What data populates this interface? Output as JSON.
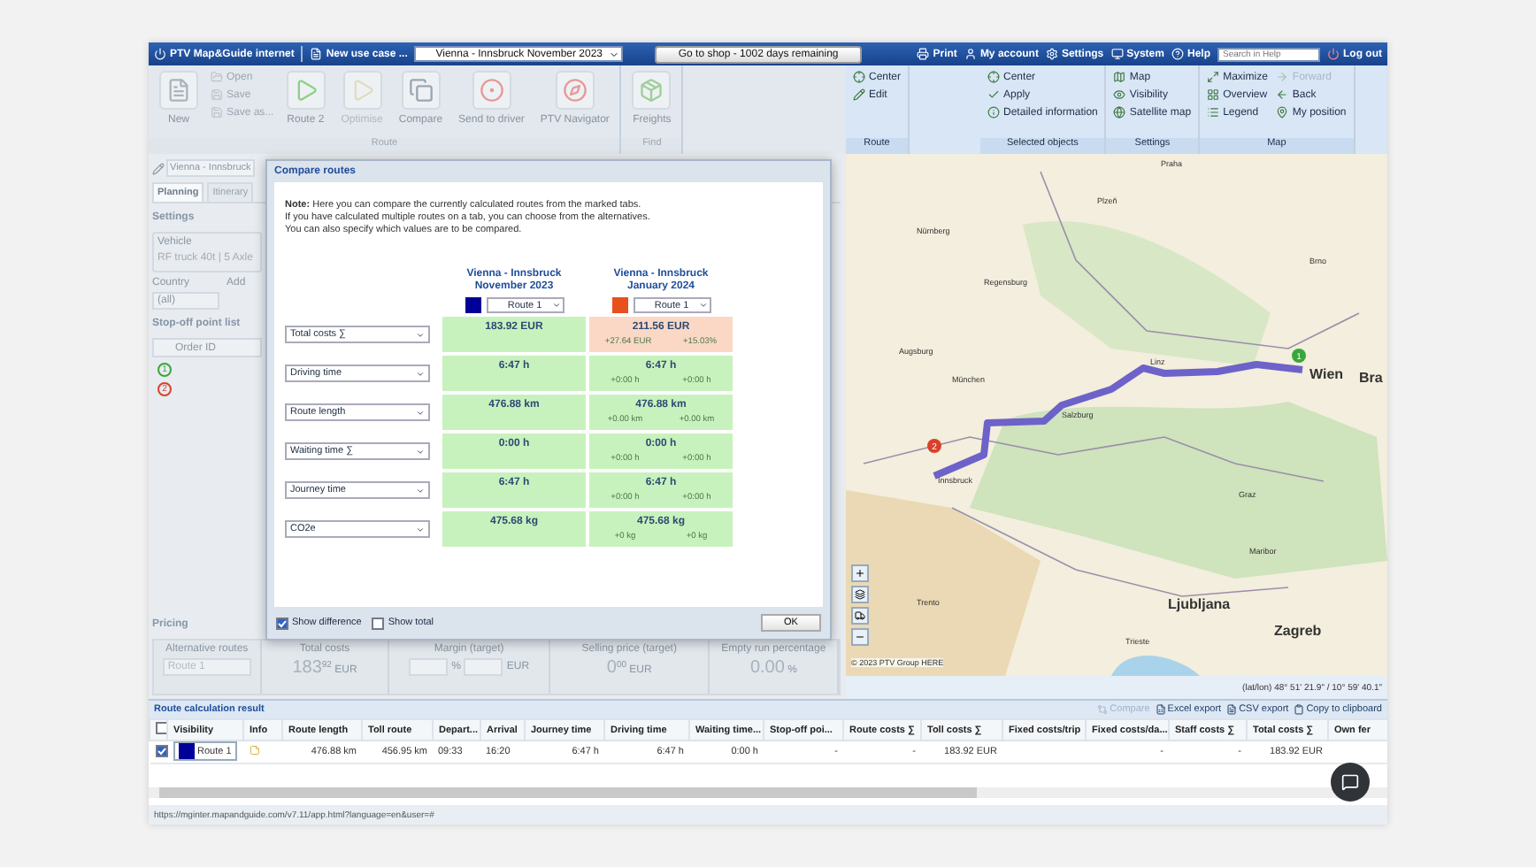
{
  "top_bar": {
    "app_title": "PTV Map&Guide internet",
    "new_use_case": "New use case ...",
    "tour_select": "Vienna - Innsbruck November 2023",
    "shop_button": "Go to shop - 1002 days remaining",
    "links": [
      "Print",
      "My account",
      "Settings",
      "System",
      "Help"
    ],
    "search": {
      "placeholder": "Search in Help"
    },
    "logout": "Log out"
  },
  "ribbon": {
    "left_groups": [
      {
        "label": "Route",
        "items": [
          {
            "kind": "big",
            "label": "New",
            "disabled": false
          },
          {
            "kind": "stack",
            "items": [
              {
                "label": "Open",
                "disabled": false
              },
              {
                "label": "Save",
                "disabled": false
              },
              {
                "label": "Save as...",
                "disabled": false
              }
            ]
          },
          {
            "kind": "big",
            "label": "Route 2",
            "disabled": false
          },
          {
            "kind": "big",
            "label": "Optimise",
            "disabled": true
          },
          {
            "kind": "big",
            "label": "Compare",
            "disabled": false
          },
          {
            "kind": "big",
            "label": "Send to driver",
            "disabled": false
          },
          {
            "kind": "big",
            "label": "PTV Navigator",
            "disabled": false
          }
        ]
      },
      {
        "label": "Find",
        "items": [
          {
            "kind": "big",
            "label": "Freights",
            "disabled": false
          }
        ]
      }
    ],
    "right_groups": [
      {
        "label": "Route",
        "columns": [
          [
            {
              "label": "Center",
              "disabled": false
            },
            {
              "label": "Edit",
              "disabled": false
            }
          ]
        ]
      },
      {
        "label": "Selected objects",
        "columns": [
          [
            {
              "label": "Center",
              "disabled": false
            },
            {
              "label": "Apply",
              "disabled": false
            },
            {
              "label": "Detailed information",
              "disabled": false
            }
          ]
        ]
      },
      {
        "label": "Settings",
        "columns": [
          [
            {
              "label": "Map",
              "disabled": false
            },
            {
              "label": "Visibility",
              "disabled": false
            },
            {
              "label": "Satellite map",
              "disabled": false
            }
          ]
        ]
      },
      {
        "label": "Map",
        "columns": [
          [
            {
              "label": "Maximize",
              "disabled": false
            },
            {
              "label": "Overview",
              "disabled": false
            },
            {
              "label": "Legend",
              "disabled": false
            }
          ],
          [
            {
              "label": "Forward",
              "disabled": true
            },
            {
              "label": "Back",
              "disabled": false
            },
            {
              "label": "My position",
              "disabled": false
            }
          ]
        ]
      }
    ]
  },
  "tour_tab": "Vienna - Innsbruck",
  "tabs": [
    {
      "label": "Planning",
      "selected": true
    },
    {
      "label": "Itinerary",
      "selected": false
    }
  ],
  "settings": {
    "title": "Settings",
    "vehicle_label": "Vehicle",
    "vehicle_value": "RF truck 40t | 5 Axle",
    "country_label": "Country",
    "country_value": "(all)",
    "address_label": "Add"
  },
  "stop_list": {
    "title": "Stop-off point list",
    "column": "Order ID",
    "stops": [
      {
        "number": "1",
        "color": "#3aa63a"
      },
      {
        "number": "2",
        "color": "#d9412b"
      }
    ]
  },
  "pricing": {
    "title": "Pricing",
    "alternative_routes": {
      "label": "Alternative routes",
      "value": "Route 1",
      "disabled": true
    },
    "total_costs": {
      "label": "Total costs",
      "integer": "183",
      "decimals": "92",
      "unit": "EUR"
    },
    "margin": {
      "label": "Margin (target)",
      "units": [
        "%",
        "EUR"
      ]
    },
    "selling_price": {
      "label": "Selling price (target)",
      "integer": "0",
      "decimals": "00",
      "unit": "EUR"
    },
    "empty_run": {
      "label": "Empty run percentage",
      "value": "0.00",
      "unit": "%"
    }
  },
  "dialog": {
    "title": "Compare routes",
    "note": [
      "**Note:** Here you can compare the currently calculated routes from the marked tabs.",
      "If you have calculated multiple routes on a tab, you can choose from the alternatives.",
      "You can also specify which values are to be compared."
    ],
    "routes": [
      {
        "name": "Vienna - Innsbruck November 2023",
        "color": "#000099",
        "alternative": "Route 1"
      },
      {
        "name": "Vienna - Innsbruck January 2024",
        "color": "#e8501e",
        "alternative": "Route 1"
      }
    ],
    "rows": [
      {
        "criterion": "Total costs ∑",
        "cells": [
          {
            "value": "183.92 EUR",
            "worse": false
          },
          {
            "value": "211.56 EUR",
            "worse": true,
            "diffs": [
              "+27.64 EUR",
              "+15.03%"
            ]
          }
        ]
      },
      {
        "criterion": "Driving time",
        "cells": [
          {
            "value": "6:47 h",
            "worse": false
          },
          {
            "value": "6:47 h",
            "worse": false,
            "diffs": [
              "+0:00 h",
              "+0:00 h"
            ]
          }
        ]
      },
      {
        "criterion": "Route length",
        "cells": [
          {
            "value": "476.88 km",
            "worse": false
          },
          {
            "value": "476.88 km",
            "worse": false,
            "diffs": [
              "+0.00 km",
              "+0.00 km"
            ]
          }
        ]
      },
      {
        "criterion": "Waiting time ∑",
        "cells": [
          {
            "value": "0:00 h",
            "worse": false
          },
          {
            "value": "0:00 h",
            "worse": false,
            "diffs": [
              "+0:00 h",
              "+0:00 h"
            ]
          }
        ]
      },
      {
        "criterion": "Journey time",
        "cells": [
          {
            "value": "6:47 h",
            "worse": false
          },
          {
            "value": "6:47 h",
            "worse": false,
            "diffs": [
              "+0:00 h",
              "+0:00 h"
            ]
          }
        ]
      },
      {
        "criterion": "CO2e",
        "cells": [
          {
            "value": "475.68 kg",
            "worse": false
          },
          {
            "value": "475.68 kg",
            "worse": false,
            "diffs": [
              "+0 kg",
              "+0 kg"
            ]
          }
        ]
      }
    ],
    "options": [
      {
        "label": "Show difference",
        "checked": true
      },
      {
        "label": "Show total",
        "checked": false
      }
    ],
    "ok": "OK"
  },
  "map": {
    "labels": [
      {
        "text": "Praha",
        "kind": "minor"
      },
      {
        "text": "Plzeň",
        "kind": "minor"
      },
      {
        "text": "Nürnberg",
        "kind": "minor"
      },
      {
        "text": "Brno",
        "kind": "minor"
      },
      {
        "text": "Regensburg",
        "kind": "minor"
      },
      {
        "text": "Augsburg",
        "kind": "minor"
      },
      {
        "text": "München",
        "kind": "minor"
      },
      {
        "text": "Linz",
        "kind": "minor"
      },
      {
        "text": "Wien",
        "kind": "major"
      },
      {
        "text": "Bra",
        "kind": "major"
      },
      {
        "text": "Salzburg",
        "kind": "minor"
      },
      {
        "text": "Innsbruck",
        "kind": "minor"
      },
      {
        "text": "Graz",
        "kind": "minor"
      },
      {
        "text": "Maribor",
        "kind": "minor"
      },
      {
        "text": "Ljubljana",
        "kind": "major"
      },
      {
        "text": "Zagreb",
        "kind": "major"
      },
      {
        "text": "Trento",
        "kind": "minor"
      },
      {
        "text": "Trieste",
        "kind": "minor"
      }
    ],
    "markers": [
      {
        "number": "1",
        "color": "#3aa63a"
      },
      {
        "number": "2",
        "color": "#d9412b"
      }
    ],
    "copyright": "© 2023 PTV Group HERE",
    "coordinates": "(lat/lon) 48° 51' 21.9\" / 10° 59' 40.1\""
  },
  "results": {
    "title": "Route calculation result",
    "toolbar": [
      {
        "label": "Compare",
        "disabled": true
      },
      {
        "label": "Excel export",
        "disabled": false
      },
      {
        "label": "CSV export",
        "disabled": false
      },
      {
        "label": "Copy to clipboard",
        "disabled": false
      }
    ],
    "select_all": false,
    "columns": [
      "Visibility",
      "Info",
      "Route length",
      "Toll route",
      "Depart...",
      "Arrival",
      "Journey time",
      "Driving time",
      "Waiting time...",
      "Stop-off poi...",
      "Route costs ∑",
      "Toll costs ∑",
      "Fixed costs/trip",
      "Fixed costs/da...",
      "Staff costs ∑",
      "Total costs ∑",
      "Own fer"
    ],
    "rows": [
      {
        "checked": true,
        "color": "#000099",
        "cells": [
          "Route 1",
          "",
          "476.88 km",
          "456.95 km",
          "09:33",
          "16:20",
          "6:47 h",
          "6:47 h",
          "0:00 h",
          "-",
          "-",
          "183.92 EUR",
          "",
          "-",
          "-",
          "183.92 EUR",
          ""
        ]
      }
    ]
  },
  "status_bar": {
    "url": "https://mginter.mapandguide.com/v7.11/app.html?language=en&user=#"
  }
}
